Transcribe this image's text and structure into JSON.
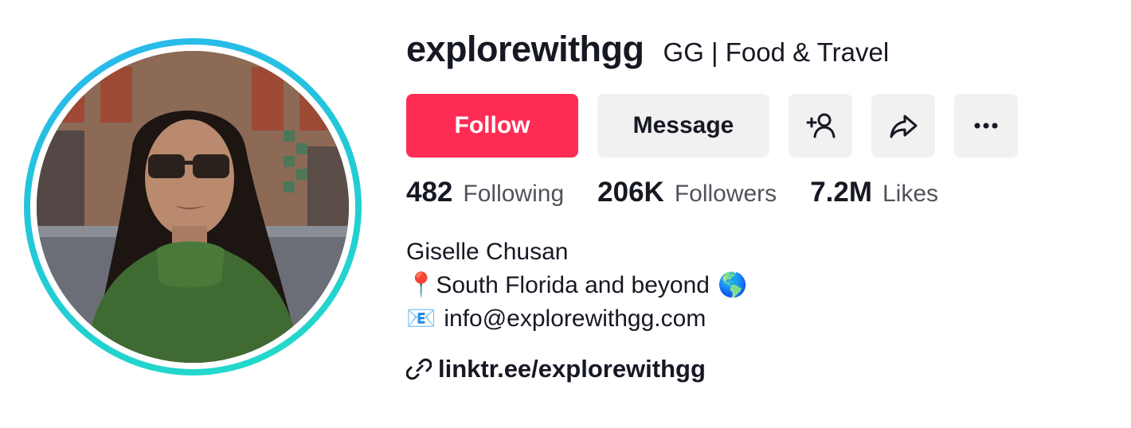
{
  "profile": {
    "username": "explorewithgg",
    "display_name": "GG | Food & Travel",
    "avatar_ring_colors": [
      "#2bb6f0",
      "#22dcc8"
    ]
  },
  "actions": {
    "follow_label": "Follow",
    "message_label": "Message",
    "follow_color": "#fe2c55",
    "add_friend_icon": "person-plus-icon",
    "share_icon": "share-arrow-icon",
    "more_icon": "more-dots-icon"
  },
  "stats": {
    "following_count": "482",
    "following_label": "Following",
    "followers_count": "206K",
    "followers_label": "Followers",
    "likes_count": "7.2M",
    "likes_label": "Likes"
  },
  "bio": {
    "name_line": "Giselle Chusan",
    "location_emoji": "📍",
    "location_text": "South Florida and beyond",
    "globe_emoji": "🌎",
    "email_emoji": "📧",
    "email_text": "info@explorewithgg.com"
  },
  "link": {
    "icon": "link-icon",
    "text": "linktr.ee/explorewithgg"
  }
}
